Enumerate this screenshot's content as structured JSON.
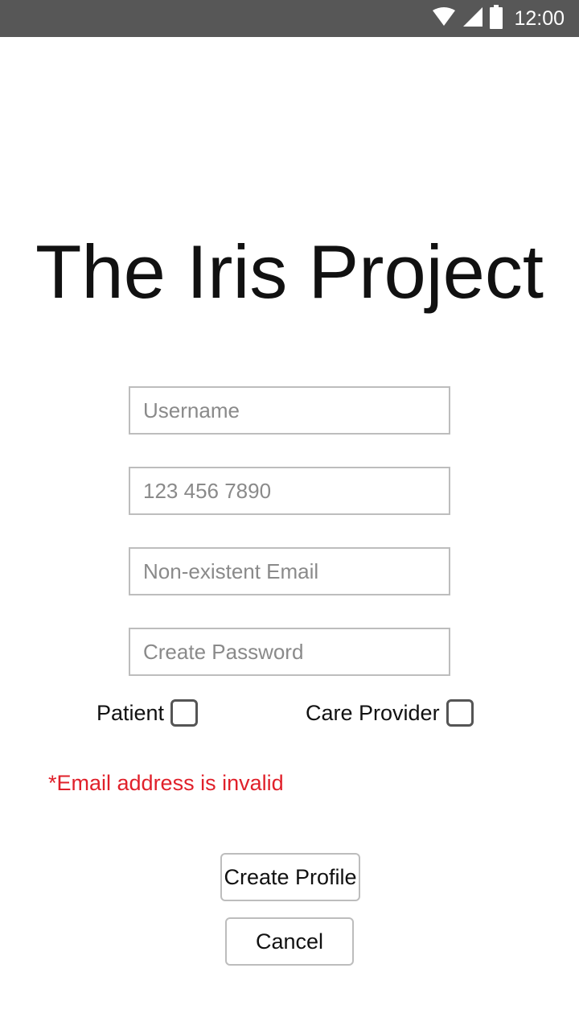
{
  "status_bar": {
    "time": "12:00",
    "icons": [
      "wifi-icon",
      "signal-icon",
      "battery-icon"
    ]
  },
  "app": {
    "title": "The Iris Project"
  },
  "form": {
    "username_placeholder": "Username",
    "phone_placeholder": "123 456 7890",
    "email_placeholder": "Non-existent Email",
    "password_placeholder": "Create Password",
    "role_patient_label": "Patient",
    "role_provider_label": "Care Provider",
    "error_message": "*Email address is invalid",
    "create_button_label": "Create Profile",
    "cancel_button_label": "Cancel"
  },
  "colors": {
    "status_bar": "#575757",
    "error": "#e0202a",
    "border": "#bdbdbd"
  }
}
